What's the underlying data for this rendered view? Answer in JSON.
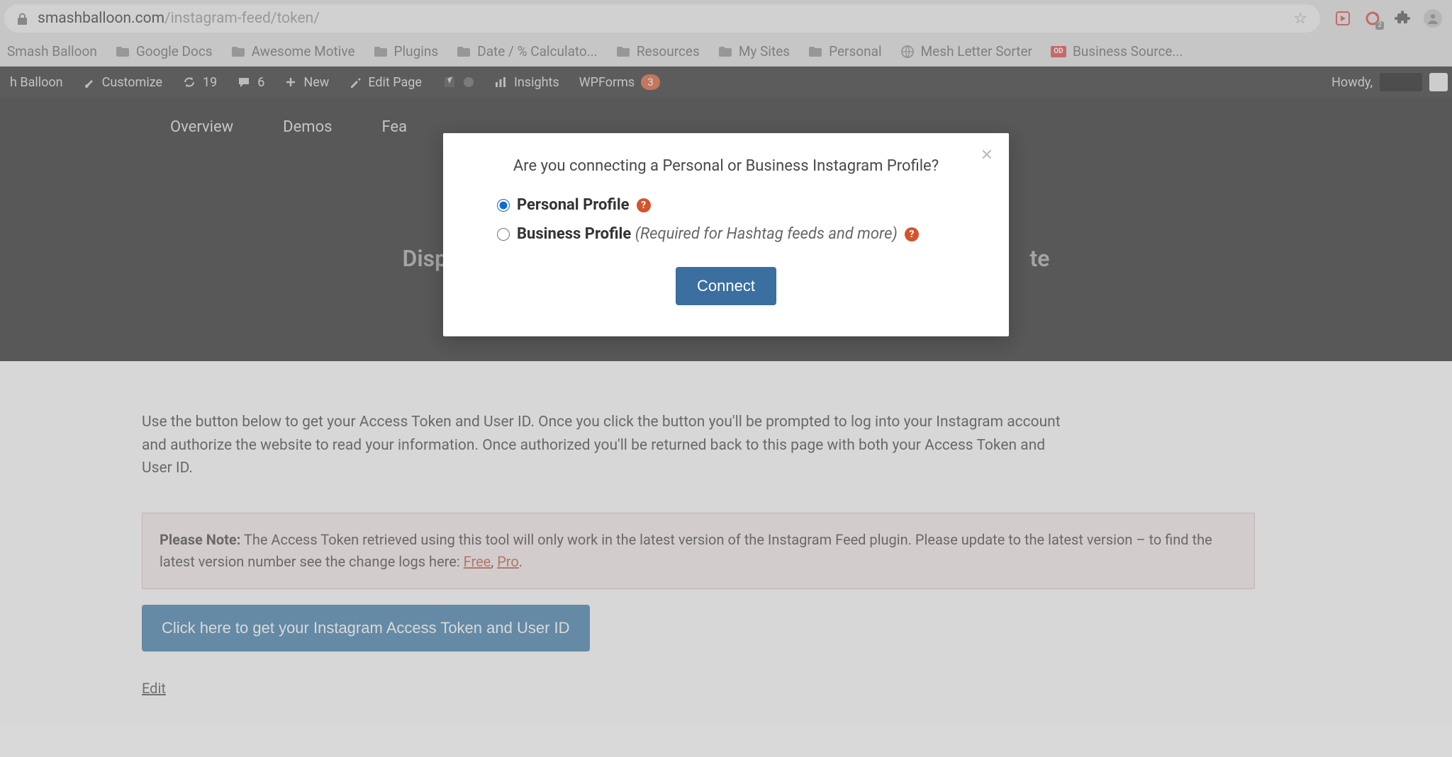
{
  "browser": {
    "url_secure": "smashballoon.com",
    "url_path": "/instagram-feed/token/",
    "badge2": "2",
    "bookmarks": [
      {
        "label": "Smash Balloon",
        "icon": "none"
      },
      {
        "label": "Google Docs",
        "icon": "folder"
      },
      {
        "label": "Awesome Motive",
        "icon": "folder"
      },
      {
        "label": "Plugins",
        "icon": "folder"
      },
      {
        "label": "Date / % Calculato...",
        "icon": "folder"
      },
      {
        "label": "Resources",
        "icon": "folder"
      },
      {
        "label": "My Sites",
        "icon": "folder"
      },
      {
        "label": "Personal",
        "icon": "folder"
      },
      {
        "label": "Mesh Letter Sorter",
        "icon": "globe"
      },
      {
        "label": "Business Source...",
        "icon": "od"
      }
    ]
  },
  "adminbar": {
    "site": "h Balloon",
    "customize": "Customize",
    "updates": "19",
    "comments": "6",
    "new": "New",
    "edit": "Edit Page",
    "insights": "Insights",
    "wpforms": "WPForms",
    "wpforms_badge": "3",
    "howdy": "Howdy,"
  },
  "sitenav": {
    "tabs": [
      "Overview",
      "Demos",
      "Fea"
    ]
  },
  "hero": {
    "left_frag": "Displa",
    "right_frag": "te"
  },
  "body": {
    "lead": "Use the button below to get your Access Token and User ID. Once you click the button you'll be prompted to log into your Instagram account and authorize the website to read your information. Once authorized you'll be returned back to this page with both your Access Token and User ID.",
    "notice_strong": "Please Note:",
    "notice_text": " The Access Token retrieved using this tool will only work in the latest version of the Instagram Feed plugin. Please update to the latest version – to find the latest version number see the change logs here: ",
    "notice_link_free": "Free",
    "notice_sep": ", ",
    "notice_link_pro": "Pro",
    "notice_end": ".",
    "big_button": "Click here to get your Instagram Access Token and User ID",
    "edit": "Edit"
  },
  "modal": {
    "question": "Are you connecting a Personal or Business Instagram Profile?",
    "personal": "Personal Profile",
    "business": "Business Profile",
    "business_sub": "(Required for Hashtag feeds and more)",
    "connect": "Connect"
  }
}
